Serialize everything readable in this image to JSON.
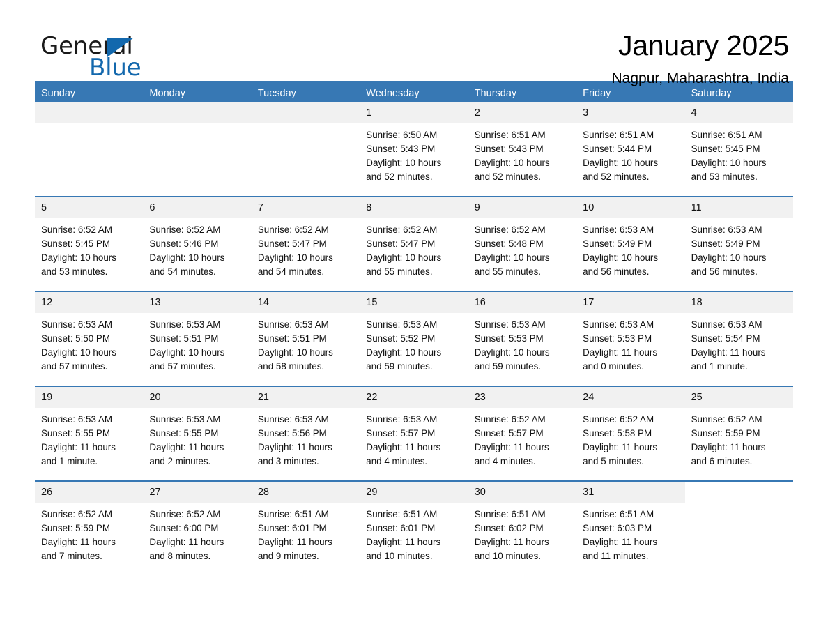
{
  "brand": {
    "word_one": "General",
    "word_two": "Blue",
    "triangle_color": "#1368ad",
    "icon": "triangle-logo-icon"
  },
  "header": {
    "month_title": "January 2025",
    "location": "Nagpur, Maharashtra, India"
  },
  "theme": {
    "header_blue": "#3778b4",
    "row_divider_blue": "#3778b4",
    "daynum_band": "#f1f1f1",
    "text": "#111111"
  },
  "calendar": {
    "weekdays": [
      "Sunday",
      "Monday",
      "Tuesday",
      "Wednesday",
      "Thursday",
      "Friday",
      "Saturday"
    ],
    "weeks": [
      [
        {
          "day": "",
          "info": "",
          "type": "empty"
        },
        {
          "day": "",
          "info": "",
          "type": "empty"
        },
        {
          "day": "",
          "info": "",
          "type": "empty"
        },
        {
          "day": "1",
          "info": "Sunrise: 6:50 AM\nSunset: 5:43 PM\nDaylight: 10 hours\nand 52 minutes.",
          "type": "day"
        },
        {
          "day": "2",
          "info": "Sunrise: 6:51 AM\nSunset: 5:43 PM\nDaylight: 10 hours\nand 52 minutes.",
          "type": "day"
        },
        {
          "day": "3",
          "info": "Sunrise: 6:51 AM\nSunset: 5:44 PM\nDaylight: 10 hours\nand 52 minutes.",
          "type": "day"
        },
        {
          "day": "4",
          "info": "Sunrise: 6:51 AM\nSunset: 5:45 PM\nDaylight: 10 hours\nand 53 minutes.",
          "type": "day"
        }
      ],
      [
        {
          "day": "5",
          "info": "Sunrise: 6:52 AM\nSunset: 5:45 PM\nDaylight: 10 hours\nand 53 minutes.",
          "type": "day"
        },
        {
          "day": "6",
          "info": "Sunrise: 6:52 AM\nSunset: 5:46 PM\nDaylight: 10 hours\nand 54 minutes.",
          "type": "day"
        },
        {
          "day": "7",
          "info": "Sunrise: 6:52 AM\nSunset: 5:47 PM\nDaylight: 10 hours\nand 54 minutes.",
          "type": "day"
        },
        {
          "day": "8",
          "info": "Sunrise: 6:52 AM\nSunset: 5:47 PM\nDaylight: 10 hours\nand 55 minutes.",
          "type": "day"
        },
        {
          "day": "9",
          "info": "Sunrise: 6:52 AM\nSunset: 5:48 PM\nDaylight: 10 hours\nand 55 minutes.",
          "type": "day"
        },
        {
          "day": "10",
          "info": "Sunrise: 6:53 AM\nSunset: 5:49 PM\nDaylight: 10 hours\nand 56 minutes.",
          "type": "day"
        },
        {
          "day": "11",
          "info": "Sunrise: 6:53 AM\nSunset: 5:49 PM\nDaylight: 10 hours\nand 56 minutes.",
          "type": "day"
        }
      ],
      [
        {
          "day": "12",
          "info": "Sunrise: 6:53 AM\nSunset: 5:50 PM\nDaylight: 10 hours\nand 57 minutes.",
          "type": "day"
        },
        {
          "day": "13",
          "info": "Sunrise: 6:53 AM\nSunset: 5:51 PM\nDaylight: 10 hours\nand 57 minutes.",
          "type": "day"
        },
        {
          "day": "14",
          "info": "Sunrise: 6:53 AM\nSunset: 5:51 PM\nDaylight: 10 hours\nand 58 minutes.",
          "type": "day"
        },
        {
          "day": "15",
          "info": "Sunrise: 6:53 AM\nSunset: 5:52 PM\nDaylight: 10 hours\nand 59 minutes.",
          "type": "day"
        },
        {
          "day": "16",
          "info": "Sunrise: 6:53 AM\nSunset: 5:53 PM\nDaylight: 10 hours\nand 59 minutes.",
          "type": "day"
        },
        {
          "day": "17",
          "info": "Sunrise: 6:53 AM\nSunset: 5:53 PM\nDaylight: 11 hours\nand 0 minutes.",
          "type": "day"
        },
        {
          "day": "18",
          "info": "Sunrise: 6:53 AM\nSunset: 5:54 PM\nDaylight: 11 hours\nand 1 minute.",
          "type": "day"
        }
      ],
      [
        {
          "day": "19",
          "info": "Sunrise: 6:53 AM\nSunset: 5:55 PM\nDaylight: 11 hours\nand 1 minute.",
          "type": "day"
        },
        {
          "day": "20",
          "info": "Sunrise: 6:53 AM\nSunset: 5:55 PM\nDaylight: 11 hours\nand 2 minutes.",
          "type": "day"
        },
        {
          "day": "21",
          "info": "Sunrise: 6:53 AM\nSunset: 5:56 PM\nDaylight: 11 hours\nand 3 minutes.",
          "type": "day"
        },
        {
          "day": "22",
          "info": "Sunrise: 6:53 AM\nSunset: 5:57 PM\nDaylight: 11 hours\nand 4 minutes.",
          "type": "day"
        },
        {
          "day": "23",
          "info": "Sunrise: 6:52 AM\nSunset: 5:57 PM\nDaylight: 11 hours\nand 4 minutes.",
          "type": "day"
        },
        {
          "day": "24",
          "info": "Sunrise: 6:52 AM\nSunset: 5:58 PM\nDaylight: 11 hours\nand 5 minutes.",
          "type": "day"
        },
        {
          "day": "25",
          "info": "Sunrise: 6:52 AM\nSunset: 5:59 PM\nDaylight: 11 hours\nand 6 minutes.",
          "type": "day"
        }
      ],
      [
        {
          "day": "26",
          "info": "Sunrise: 6:52 AM\nSunset: 5:59 PM\nDaylight: 11 hours\nand 7 minutes.",
          "type": "day"
        },
        {
          "day": "27",
          "info": "Sunrise: 6:52 AM\nSunset: 6:00 PM\nDaylight: 11 hours\nand 8 minutes.",
          "type": "day"
        },
        {
          "day": "28",
          "info": "Sunrise: 6:51 AM\nSunset: 6:01 PM\nDaylight: 11 hours\nand 9 minutes.",
          "type": "day"
        },
        {
          "day": "29",
          "info": "Sunrise: 6:51 AM\nSunset: 6:01 PM\nDaylight: 11 hours\nand 10 minutes.",
          "type": "day"
        },
        {
          "day": "30",
          "info": "Sunrise: 6:51 AM\nSunset: 6:02 PM\nDaylight: 11 hours\nand 10 minutes.",
          "type": "day"
        },
        {
          "day": "31",
          "info": "Sunrise: 6:51 AM\nSunset: 6:03 PM\nDaylight: 11 hours\nand 11 minutes.",
          "type": "day"
        },
        {
          "day": "",
          "info": "",
          "type": "blank"
        }
      ]
    ]
  }
}
